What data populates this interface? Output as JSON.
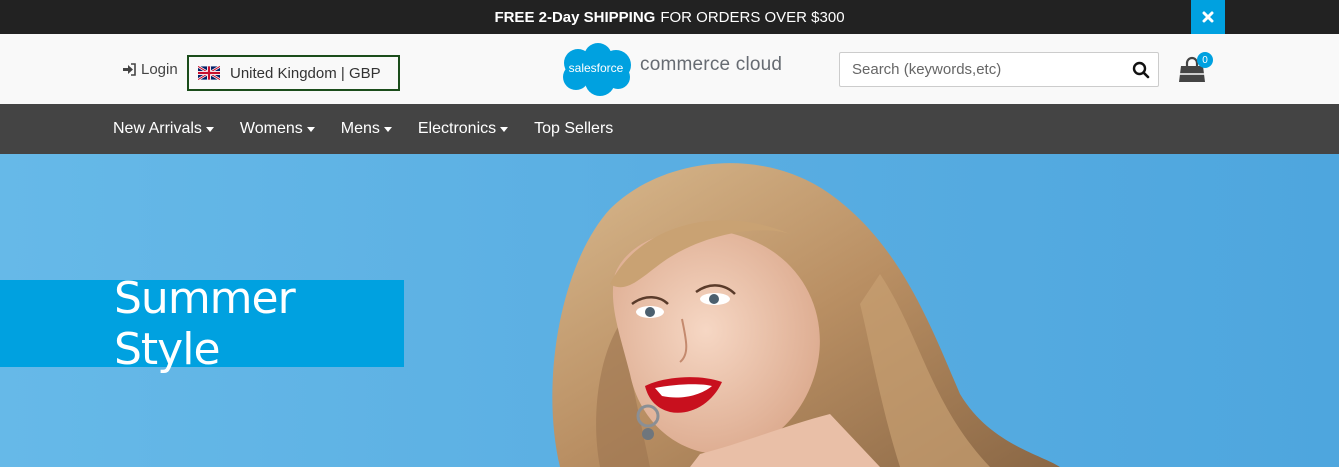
{
  "promo": {
    "bold_text": "FREE 2-Day SHIPPING",
    "text": "FOR ORDERS OVER $300",
    "close_icon": "close-icon"
  },
  "header": {
    "login_label": "Login",
    "country_label": "United Kingdom | GBP",
    "logo": {
      "cloud_text": "salesforce",
      "text": "commerce cloud"
    },
    "search": {
      "placeholder": "Search (keywords,etc)",
      "value": ""
    },
    "cart": {
      "count": "0"
    }
  },
  "nav": {
    "items": [
      {
        "label": "New Arrivals",
        "dropdown": true
      },
      {
        "label": "Womens",
        "dropdown": true
      },
      {
        "label": "Mens",
        "dropdown": true
      },
      {
        "label": "Electronics",
        "dropdown": true
      },
      {
        "label": "Top Sellers",
        "dropdown": false
      }
    ]
  },
  "hero": {
    "title": "Summer Style"
  },
  "colors": {
    "accent": "#00a1e0",
    "promo_bg": "#222222",
    "nav_bg": "#444444",
    "hero_bg": "#5eb3e4"
  }
}
